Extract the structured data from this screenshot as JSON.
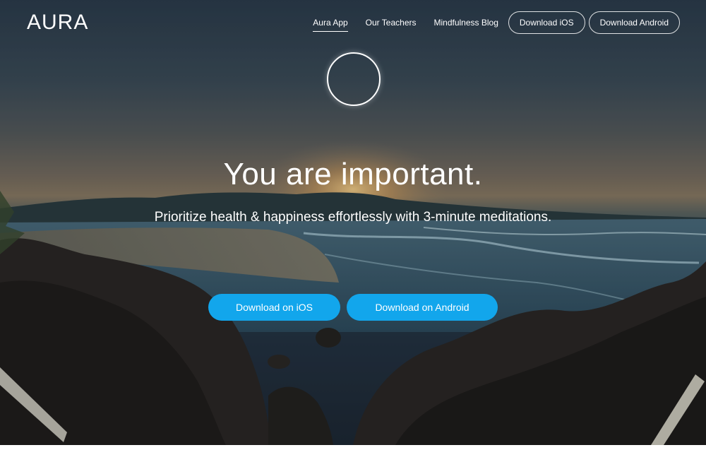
{
  "brand": {
    "logo_text": "AURA"
  },
  "nav": {
    "links": [
      {
        "label": "Aura App",
        "active": true
      },
      {
        "label": "Our Teachers",
        "active": false
      },
      {
        "label": "Mindfulness Blog",
        "active": false
      }
    ],
    "buttons": [
      {
        "label": "Download iOS"
      },
      {
        "label": "Download Android"
      }
    ]
  },
  "hero": {
    "headline": "You are important.",
    "subheadline": "Prioritize health & happiness effortlessly with 3-minute meditations.",
    "cta_ios": "Download on iOS",
    "cta_android": "Download on Android"
  },
  "colors": {
    "cta_blue": "#12a6ec",
    "text_white": "#ffffff",
    "page_background": "#ffffff"
  },
  "icons": {
    "ring": "circle-outline-icon"
  }
}
